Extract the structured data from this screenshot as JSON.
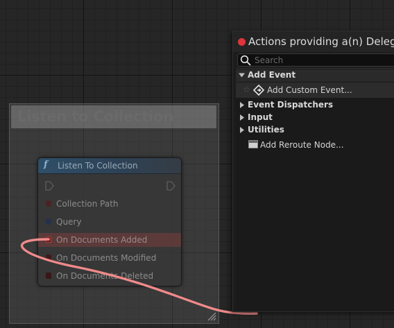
{
  "comment": {
    "title": "Listen to Collection"
  },
  "node": {
    "title": "Listen To Collection",
    "func_icon": "f",
    "pins": [
      {
        "label": "Collection Path",
        "color": "#5a2a2a",
        "highlight": false
      },
      {
        "label": "Query",
        "color": "#2a3a55",
        "highlight": false
      },
      {
        "label": "On Documents Added",
        "color": "#7a2a2a",
        "highlight": true
      },
      {
        "label": "On Documents Modified",
        "color": "#4a2020",
        "highlight": false
      },
      {
        "label": "On Documents Deleted",
        "color": "#4a1c1c",
        "highlight": false
      }
    ]
  },
  "wire": {
    "color": "#f08a8a"
  },
  "menu": {
    "title": "Actions providing a(n) Delegate",
    "close_color": "#e0353c",
    "search": {
      "placeholder": "Search",
      "value": ""
    },
    "categories": {
      "add_event": "Add Event",
      "event_dispatchers": "Event Dispatchers",
      "input": "Input",
      "utilities": "Utilities"
    },
    "items": {
      "add_custom_event": "Add Custom Event...",
      "add_reroute_node": "Add Reroute Node..."
    }
  },
  "icons": [
    "search-icon",
    "star-icon",
    "diamond-event-icon",
    "reroute-icon",
    "collapse-arrow-icon",
    "expand-arrow-icon",
    "resize-grip-icon",
    "exec-pin-icon",
    "function-icon"
  ]
}
